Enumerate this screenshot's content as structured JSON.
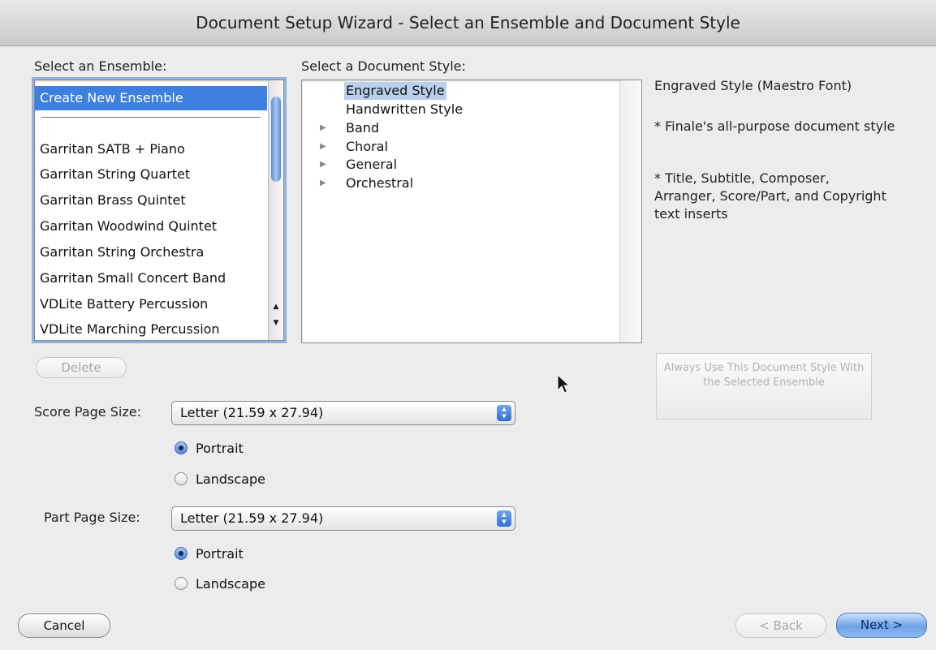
{
  "window": {
    "title": "Document Setup Wizard - Select an Ensemble and Document Style"
  },
  "ensemble": {
    "label": "Select an Ensemble:",
    "items": [
      "Create New Ensemble",
      "Garritan SATB + Piano",
      "Garritan String Quartet",
      "Garritan Brass Quintet",
      "Garritan Woodwind Quintet",
      "Garritan String Orchestra",
      "Garritan Small Concert Band",
      "VDLite Battery Percussion",
      "VDLite Marching Percussion"
    ],
    "selected": "Create New Ensemble",
    "delete_label": "Delete"
  },
  "style": {
    "label": "Select a Document Style:",
    "items": [
      "Engraved Style",
      "Handwritten Style",
      "Band",
      "Choral",
      "General",
      "Orchestral"
    ],
    "selected": "Engraved Style",
    "description": {
      "title": "Engraved Style (Maestro Font)",
      "line1": "* Finale's all-purpose document style",
      "line2": "* Title, Subtitle, Composer, Arranger, Score/Part, and Copyright text inserts"
    },
    "always_use_label": "Always Use This Document Style With the Selected Ensemble"
  },
  "score": {
    "label": "Score Page Size:",
    "value": "Letter (21.59 x 27.94)",
    "orientation": "Portrait",
    "portrait_label": "Portrait",
    "landscape_label": "Landscape"
  },
  "part": {
    "label": "Part Page Size:",
    "value": "Letter (21.59 x 27.94)",
    "orientation": "Portrait",
    "portrait_label": "Portrait",
    "landscape_label": "Landscape"
  },
  "footer": {
    "cancel": "Cancel",
    "back": "< Back",
    "next": "Next >"
  },
  "colors": {
    "selection": "#3d80df",
    "default_button": "#6ca2e8"
  }
}
